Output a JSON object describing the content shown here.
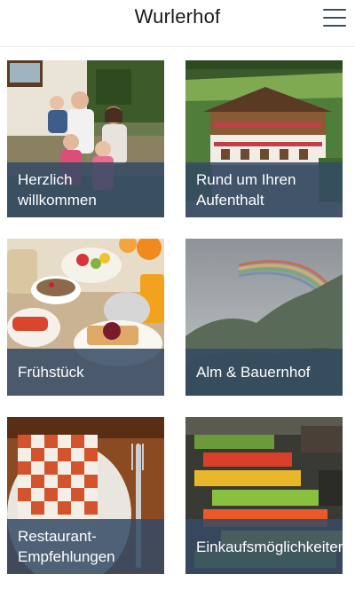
{
  "header": {
    "title": "Wurlerhof",
    "menu_icon": "hamburger-menu-icon"
  },
  "tiles": [
    {
      "label": "Herzlich willkommen",
      "image": "family-photo"
    },
    {
      "label": "Rund um Ihren Aufenthalt",
      "image": "hotel-building-photo"
    },
    {
      "label": "Frühstück",
      "image": "breakfast-table-photo"
    },
    {
      "label": "Alm & Bauernhof",
      "image": "rainbow-mountain-photo"
    },
    {
      "label": "Restaurant-Empfehlungen",
      "image": "place-setting-photo"
    },
    {
      "label": "Einkaufsmöglichkeiten",
      "image": "market-stall-photo"
    }
  ],
  "colors": {
    "caption_overlay": "#344a64",
    "menu_icon": "#3a5064",
    "title_text": "#1a1a1a"
  }
}
